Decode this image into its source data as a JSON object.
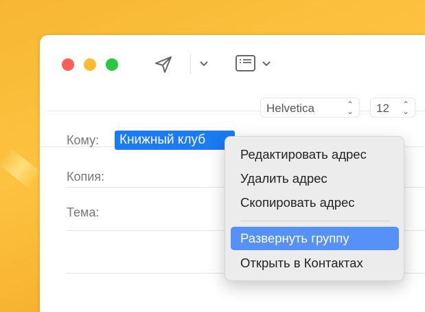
{
  "toolbar": {
    "send_icon": "paper-plane-icon",
    "header_icon": "header-fields-icon"
  },
  "format_bar": {
    "font": "Helvetica",
    "size": "12"
  },
  "fields": {
    "to_label": "Кому:",
    "to_token": "Книжный клуб",
    "cc_label": "Копия:",
    "subject_label": "Тема:"
  },
  "context_menu": {
    "items": [
      "Редактировать адрес",
      "Удалить адрес",
      "Скопировать адрес",
      "Развернуть группу",
      "Открыть в Контактах"
    ],
    "highlighted": "Развернуть группу"
  },
  "colors": {
    "token": "#1a7bf2",
    "highlight": "#5591f7"
  }
}
